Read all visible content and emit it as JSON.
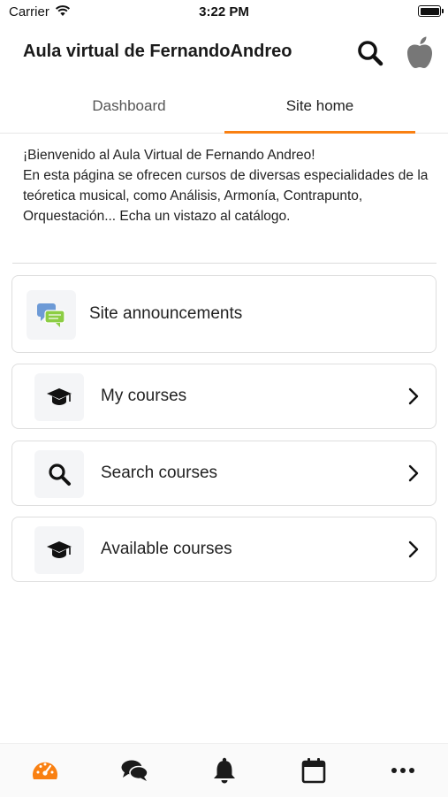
{
  "status_bar": {
    "carrier": "Carrier",
    "time": "3:22 PM"
  },
  "header": {
    "title": "Aula virtual de FernandoAndreo"
  },
  "tabs": [
    {
      "label": "Dashboard",
      "active": false
    },
    {
      "label": "Site home",
      "active": true
    }
  ],
  "summary": {
    "line1": "¡Bienvenido al Aula Virtual de Fernando Andreo!",
    "line2": "En esta página se ofrecen cursos de diversas especialidades de la teóretica musical, como Análisis, Armonía, Contrapunto, Orquestación... Echa un vistazo al catálogo."
  },
  "items": [
    {
      "label": "Site announcements",
      "icon": "forum-icon"
    },
    {
      "label": "My courses",
      "icon": "graduation-cap-icon"
    },
    {
      "label": "Search courses",
      "icon": "search-icon"
    },
    {
      "label": "Available courses",
      "icon": "graduation-cap-icon"
    }
  ],
  "bottom_nav": [
    {
      "icon": "dashboard-gauge-icon",
      "active": true
    },
    {
      "icon": "messages-icon",
      "active": false
    },
    {
      "icon": "notifications-bell-icon",
      "active": false
    },
    {
      "icon": "calendar-icon",
      "active": false
    },
    {
      "icon": "more-icon",
      "active": false
    }
  ],
  "colors": {
    "accent": "#f98012",
    "text": "#222222",
    "card_border": "#dedede"
  }
}
